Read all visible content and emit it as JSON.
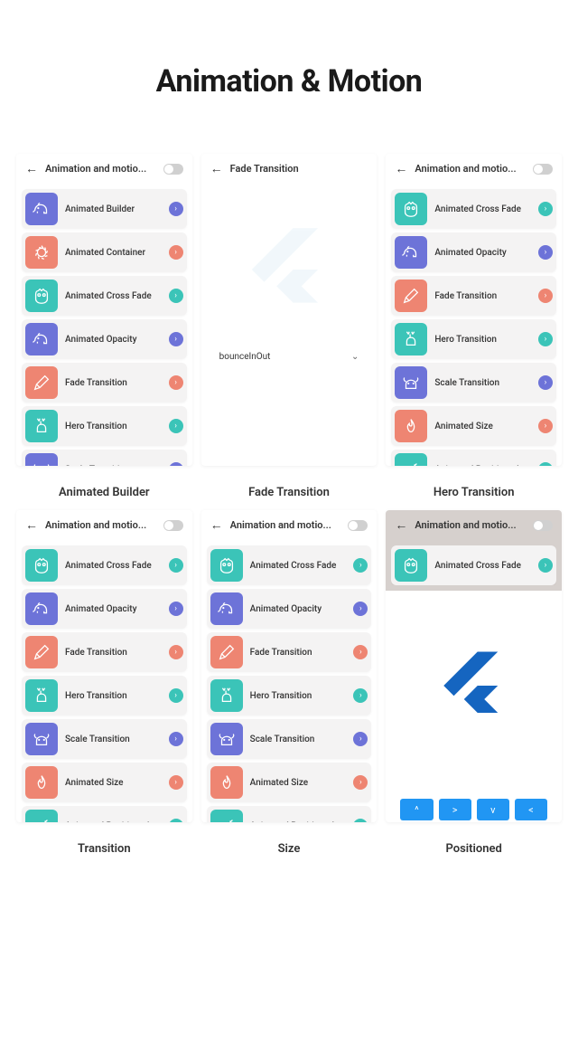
{
  "page_title": "Animation & Motion",
  "headers": {
    "animation_motion": "Animation and motio...",
    "fade_transition": "Fade Transition"
  },
  "captions": {
    "animated_builder": "Animated Builder",
    "fade_transition": "Fade Transition",
    "hero_transition": "Hero Transition",
    "transition": "Transition",
    "size": "Size",
    "positioned": "Positioned"
  },
  "colors": {
    "teal": "#3bc4b8",
    "indigo": "#6d73d8",
    "coral": "#ee8572",
    "blue": "#2196f3"
  },
  "dropdown": {
    "value": "bounceInOut"
  },
  "nav_buttons": [
    "^",
    ">",
    "v",
    "<"
  ],
  "list_a": [
    {
      "icon": "elephant",
      "color": "indigo",
      "label": "Animated Builder",
      "chev": "indigo"
    },
    {
      "icon": "lion",
      "color": "coral",
      "label": "Animated Container",
      "chev": "coral"
    },
    {
      "icon": "owl",
      "color": "teal",
      "label": "Animated Cross Fade",
      "chev": "teal"
    },
    {
      "icon": "elephant",
      "color": "indigo",
      "label": "Animated Opacity",
      "chev": "indigo"
    },
    {
      "icon": "pencil",
      "color": "coral",
      "label": "Fade Transition",
      "chev": "coral"
    },
    {
      "icon": "deer",
      "color": "teal",
      "label": "Hero Transition",
      "chev": "teal"
    },
    {
      "icon": "bull",
      "color": "indigo",
      "label": "Scale Transition",
      "chev": "indigo"
    }
  ],
  "list_b": [
    {
      "icon": "owl",
      "color": "teal",
      "label": "Animated Cross Fade",
      "chev": "teal"
    },
    {
      "icon": "elephant",
      "color": "indigo",
      "label": "Animated Opacity",
      "chev": "indigo"
    },
    {
      "icon": "pencil",
      "color": "coral",
      "label": "Fade Transition",
      "chev": "coral"
    },
    {
      "icon": "deer",
      "color": "teal",
      "label": "Hero Transition",
      "chev": "teal"
    },
    {
      "icon": "bull",
      "color": "indigo",
      "label": "Scale Transition",
      "chev": "indigo"
    },
    {
      "icon": "fire",
      "color": "coral",
      "label": "Animated Size",
      "chev": "coral"
    },
    {
      "icon": "wand",
      "color": "teal",
      "label": "Animated Positioned",
      "chev": "teal"
    }
  ],
  "list_single": [
    {
      "icon": "owl",
      "color": "teal",
      "label": "Animated Cross Fade",
      "chev": "teal"
    }
  ]
}
